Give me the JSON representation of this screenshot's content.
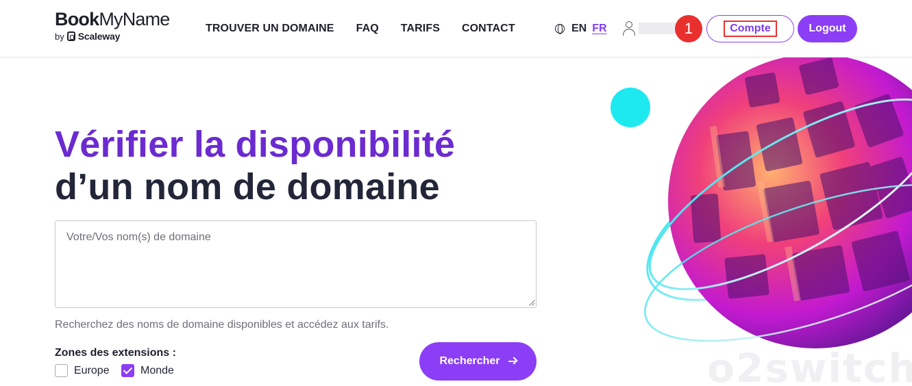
{
  "logo": {
    "main_bold": "Book",
    "main_regular": "MyName",
    "by": "by",
    "brand": "Scaleway"
  },
  "nav": {
    "items": [
      "TROUVER UN DOMAINE",
      "FAQ",
      "TARIFS",
      "CONTACT"
    ]
  },
  "lang": {
    "icon": "globe-icon",
    "en": "EN",
    "fr": "FR",
    "active": "FR"
  },
  "user": {
    "icon": "user-icon"
  },
  "annotation": {
    "badge": "1"
  },
  "buttons": {
    "compte": "Compte",
    "logout": "Logout",
    "search": "Rechercher"
  },
  "hero": {
    "title_line1": "Vérifier la disponibilité",
    "title_line2": "d’un nom de domaine"
  },
  "search": {
    "placeholder": "Votre/Vos nom(s) de domaine",
    "value": "",
    "helper": "Recherchez des noms de domaine disponibles et accédez aux tarifs."
  },
  "zones": {
    "label": "Zones des extensions :",
    "options": [
      {
        "label": "Europe",
        "checked": false
      },
      {
        "label": "Monde",
        "checked": true
      }
    ]
  },
  "watermark": "o2switch",
  "colors": {
    "accent": "#8b3ef5",
    "title_purple": "#6b2bd0",
    "badge_red": "#e8312f",
    "text_dark": "#222638"
  }
}
